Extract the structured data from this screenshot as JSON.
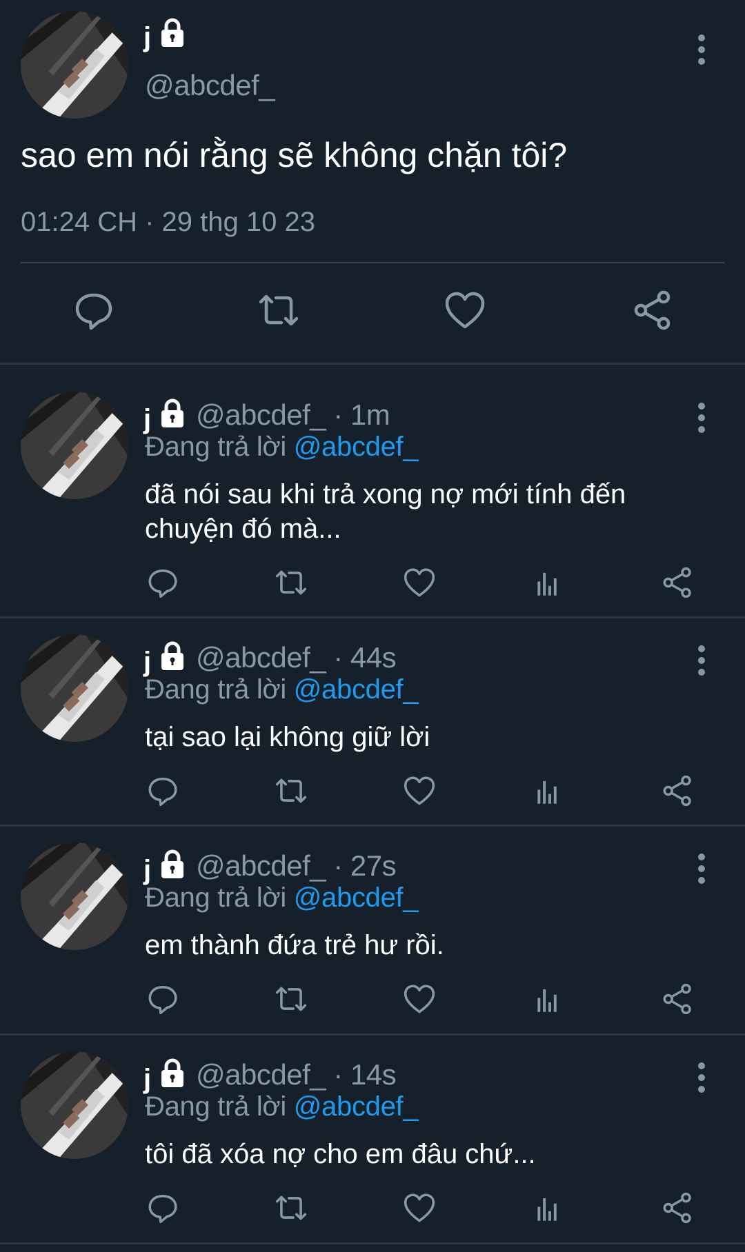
{
  "main_tweet": {
    "display_name": "j",
    "handle": "@abcdef_",
    "text": "sao em nói rằng sẽ không chặn tôi?",
    "timestamp": "01:24 CH · 29 thg 10 23",
    "icons": [
      "reply-icon",
      "retweet-icon",
      "like-icon",
      "share-icon",
      "lock-icon",
      "more-icon"
    ]
  },
  "replies": [
    {
      "display_name": "j",
      "handle_time": "@abcdef_ · 1m",
      "replying_label": "Đang trả lời ",
      "replying_to": "@abcdef_",
      "text": "đã nói sau khi trả xong nợ mới tính đến chuyện đó mà..."
    },
    {
      "display_name": "j",
      "handle_time": "@abcdef_ · 44s",
      "replying_label": "Đang trả lời ",
      "replying_to": "@abcdef_",
      "text": "tại sao lại không giữ lời"
    },
    {
      "display_name": "j",
      "handle_time": "@abcdef_ · 27s",
      "replying_label": "Đang trả lời ",
      "replying_to": "@abcdef_",
      "text": "em thành đứa trẻ hư rồi."
    },
    {
      "display_name": "j",
      "handle_time": "@abcdef_ · 14s",
      "replying_label": "Đang trả lời ",
      "replying_to": "@abcdef_",
      "text": "tôi đã xóa nợ cho em đâu chứ..."
    }
  ],
  "reply_action_icons": [
    "reply-icon",
    "retweet-icon",
    "like-icon",
    "analytics-icon",
    "share-icon"
  ],
  "colors": {
    "background": "#15202b",
    "text_primary": "#ffffff",
    "text_secondary": "#8899a6",
    "mention": "#1d9bf0",
    "divider": "#38444d"
  }
}
